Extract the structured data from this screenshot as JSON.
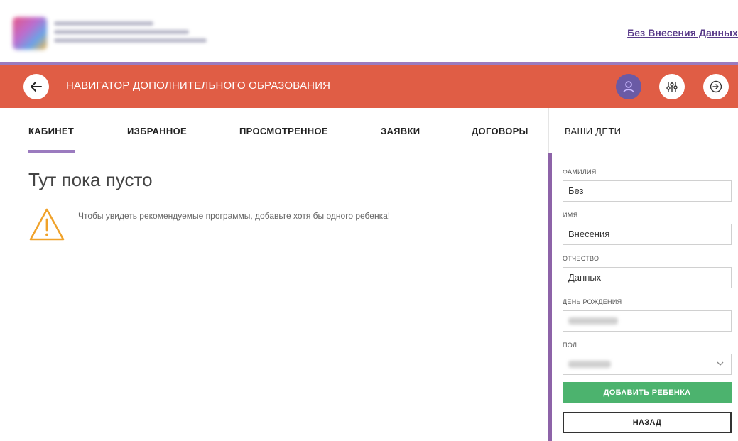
{
  "header": {
    "user_link": "Без Внесения Данных"
  },
  "navbar": {
    "title": "НАВИГАТОР ДОПОЛНИТЕЛЬНОГО ОБРАЗОВАНИЯ",
    "icons": [
      "arrow-left-icon",
      "user-icon",
      "sliders-icon",
      "exit-icon"
    ]
  },
  "tabs": [
    {
      "label": "КАБИНЕТ",
      "active": true
    },
    {
      "label": "ИЗБРАННОЕ"
    },
    {
      "label": "ПРОСМОТРЕННОЕ"
    },
    {
      "label": "ЗАЯВКИ"
    },
    {
      "label": "ДОГОВОРЫ"
    }
  ],
  "main": {
    "empty_title": "Тут пока пусто",
    "warning": "Чтобы увидеть рекомендуемые программы, добавьте хотя бы одного ребенка!"
  },
  "kids_panel": {
    "title": "ВАШИ ДЕТИ",
    "surname_label": "ФАМИЛИЯ",
    "surname_value": "Без",
    "name_label": "ИМЯ",
    "name_value": "Внесения",
    "patronymic_label": "ОТЧЕСТВО",
    "patronymic_value": "Данных",
    "birthday_label": "ДЕНЬ РОЖДЕНИЯ",
    "gender_label": "ПОЛ",
    "add_button": "ДОБАВИТЬ РЕБЕНКА",
    "back_button": "НАЗАД"
  },
  "colors": {
    "navbar": "#e05d45",
    "accent": "#9b7bbf",
    "panel_border": "#8d63a8",
    "add_button": "#4cb36e",
    "profile_circle": "#6a5aa5",
    "warning_icon": "#f0a22a"
  }
}
